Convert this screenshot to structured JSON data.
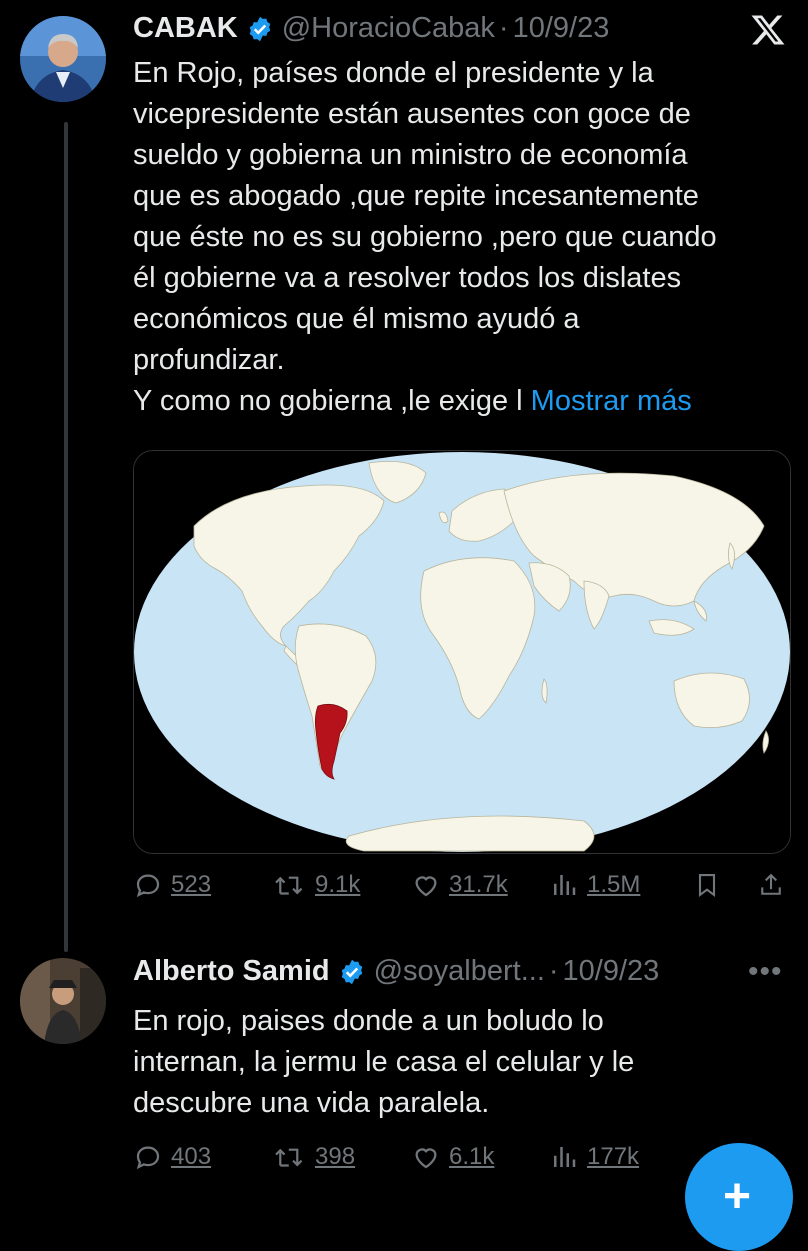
{
  "tweet1": {
    "name": "CABAK",
    "handle": "@HoracioCabak",
    "sep": "·",
    "date": "10/9/23",
    "lines": [
      "En Rojo, países donde el presidente y la",
      "vicepresidente están ausentes con goce de",
      "sueldo y gobierna un ministro de economía",
      "que es abogado ,que repite incesantemente",
      "que éste no es su gobierno ,pero que cuando",
      "él gobierne va a resolver todos los dislates",
      "económicos que él mismo ayudó a",
      "profundizar."
    ],
    "last_line": "Y como no gobierna ,le exige l",
    "show_more": "Mostrar más",
    "replies": "523",
    "retweets": "9.1k",
    "likes": "31.7k",
    "views": "1.5M"
  },
  "tweet2": {
    "name": "Alberto Samid",
    "handle": "@soyalbert...",
    "sep": "·",
    "date": "10/9/23",
    "lines": [
      "En rojo, paises donde a un boludo lo",
      "internan, la jermu le casa el celular y le",
      "descubre una vida paralela."
    ],
    "replies": "403",
    "retweets": "398",
    "likes": "6.1k",
    "views": "177k",
    "more_label": "•••"
  },
  "fab_label": "+",
  "colors": {
    "background": "#000000",
    "text": "#e7e9ea",
    "muted": "#71767b",
    "accent": "#1d9bf0",
    "map_ocean": "#c8e4f5",
    "map_land": "#f7f5e8",
    "map_highlight": "#b5121b"
  },
  "icons": [
    "x-logo-icon",
    "verified-badge-icon",
    "reply-icon",
    "retweet-icon",
    "like-icon",
    "views-icon",
    "bookmark-icon",
    "share-icon",
    "more-icon"
  ]
}
